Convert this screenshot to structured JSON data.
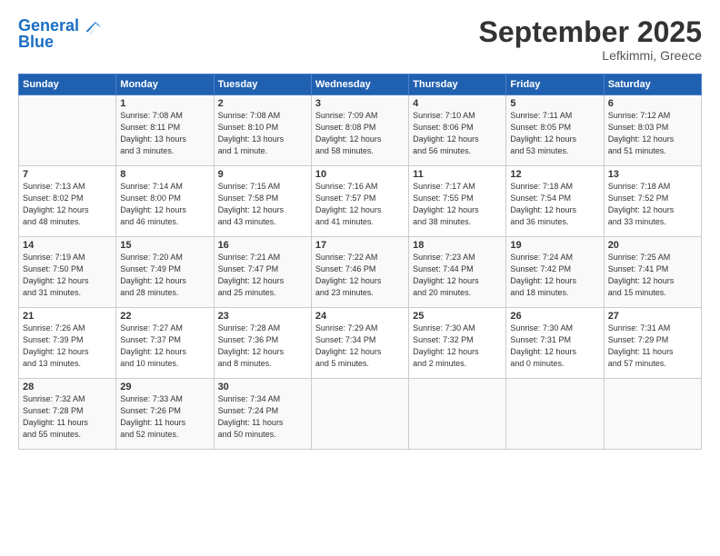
{
  "header": {
    "logo_line1": "General",
    "logo_line2": "Blue",
    "month": "September 2025",
    "location": "Lefkimmi, Greece"
  },
  "days_of_week": [
    "Sunday",
    "Monday",
    "Tuesday",
    "Wednesday",
    "Thursday",
    "Friday",
    "Saturday"
  ],
  "weeks": [
    [
      {
        "day": "",
        "info": ""
      },
      {
        "day": "1",
        "info": "Sunrise: 7:08 AM\nSunset: 8:11 PM\nDaylight: 13 hours\nand 3 minutes."
      },
      {
        "day": "2",
        "info": "Sunrise: 7:08 AM\nSunset: 8:10 PM\nDaylight: 13 hours\nand 1 minute."
      },
      {
        "day": "3",
        "info": "Sunrise: 7:09 AM\nSunset: 8:08 PM\nDaylight: 12 hours\nand 58 minutes."
      },
      {
        "day": "4",
        "info": "Sunrise: 7:10 AM\nSunset: 8:06 PM\nDaylight: 12 hours\nand 56 minutes."
      },
      {
        "day": "5",
        "info": "Sunrise: 7:11 AM\nSunset: 8:05 PM\nDaylight: 12 hours\nand 53 minutes."
      },
      {
        "day": "6",
        "info": "Sunrise: 7:12 AM\nSunset: 8:03 PM\nDaylight: 12 hours\nand 51 minutes."
      }
    ],
    [
      {
        "day": "7",
        "info": "Sunrise: 7:13 AM\nSunset: 8:02 PM\nDaylight: 12 hours\nand 48 minutes."
      },
      {
        "day": "8",
        "info": "Sunrise: 7:14 AM\nSunset: 8:00 PM\nDaylight: 12 hours\nand 46 minutes."
      },
      {
        "day": "9",
        "info": "Sunrise: 7:15 AM\nSunset: 7:58 PM\nDaylight: 12 hours\nand 43 minutes."
      },
      {
        "day": "10",
        "info": "Sunrise: 7:16 AM\nSunset: 7:57 PM\nDaylight: 12 hours\nand 41 minutes."
      },
      {
        "day": "11",
        "info": "Sunrise: 7:17 AM\nSunset: 7:55 PM\nDaylight: 12 hours\nand 38 minutes."
      },
      {
        "day": "12",
        "info": "Sunrise: 7:18 AM\nSunset: 7:54 PM\nDaylight: 12 hours\nand 36 minutes."
      },
      {
        "day": "13",
        "info": "Sunrise: 7:18 AM\nSunset: 7:52 PM\nDaylight: 12 hours\nand 33 minutes."
      }
    ],
    [
      {
        "day": "14",
        "info": "Sunrise: 7:19 AM\nSunset: 7:50 PM\nDaylight: 12 hours\nand 31 minutes."
      },
      {
        "day": "15",
        "info": "Sunrise: 7:20 AM\nSunset: 7:49 PM\nDaylight: 12 hours\nand 28 minutes."
      },
      {
        "day": "16",
        "info": "Sunrise: 7:21 AM\nSunset: 7:47 PM\nDaylight: 12 hours\nand 25 minutes."
      },
      {
        "day": "17",
        "info": "Sunrise: 7:22 AM\nSunset: 7:46 PM\nDaylight: 12 hours\nand 23 minutes."
      },
      {
        "day": "18",
        "info": "Sunrise: 7:23 AM\nSunset: 7:44 PM\nDaylight: 12 hours\nand 20 minutes."
      },
      {
        "day": "19",
        "info": "Sunrise: 7:24 AM\nSunset: 7:42 PM\nDaylight: 12 hours\nand 18 minutes."
      },
      {
        "day": "20",
        "info": "Sunrise: 7:25 AM\nSunset: 7:41 PM\nDaylight: 12 hours\nand 15 minutes."
      }
    ],
    [
      {
        "day": "21",
        "info": "Sunrise: 7:26 AM\nSunset: 7:39 PM\nDaylight: 12 hours\nand 13 minutes."
      },
      {
        "day": "22",
        "info": "Sunrise: 7:27 AM\nSunset: 7:37 PM\nDaylight: 12 hours\nand 10 minutes."
      },
      {
        "day": "23",
        "info": "Sunrise: 7:28 AM\nSunset: 7:36 PM\nDaylight: 12 hours\nand 8 minutes."
      },
      {
        "day": "24",
        "info": "Sunrise: 7:29 AM\nSunset: 7:34 PM\nDaylight: 12 hours\nand 5 minutes."
      },
      {
        "day": "25",
        "info": "Sunrise: 7:30 AM\nSunset: 7:32 PM\nDaylight: 12 hours\nand 2 minutes."
      },
      {
        "day": "26",
        "info": "Sunrise: 7:30 AM\nSunset: 7:31 PM\nDaylight: 12 hours\nand 0 minutes."
      },
      {
        "day": "27",
        "info": "Sunrise: 7:31 AM\nSunset: 7:29 PM\nDaylight: 11 hours\nand 57 minutes."
      }
    ],
    [
      {
        "day": "28",
        "info": "Sunrise: 7:32 AM\nSunset: 7:28 PM\nDaylight: 11 hours\nand 55 minutes."
      },
      {
        "day": "29",
        "info": "Sunrise: 7:33 AM\nSunset: 7:26 PM\nDaylight: 11 hours\nand 52 minutes."
      },
      {
        "day": "30",
        "info": "Sunrise: 7:34 AM\nSunset: 7:24 PM\nDaylight: 11 hours\nand 50 minutes."
      },
      {
        "day": "",
        "info": ""
      },
      {
        "day": "",
        "info": ""
      },
      {
        "day": "",
        "info": ""
      },
      {
        "day": "",
        "info": ""
      }
    ]
  ]
}
